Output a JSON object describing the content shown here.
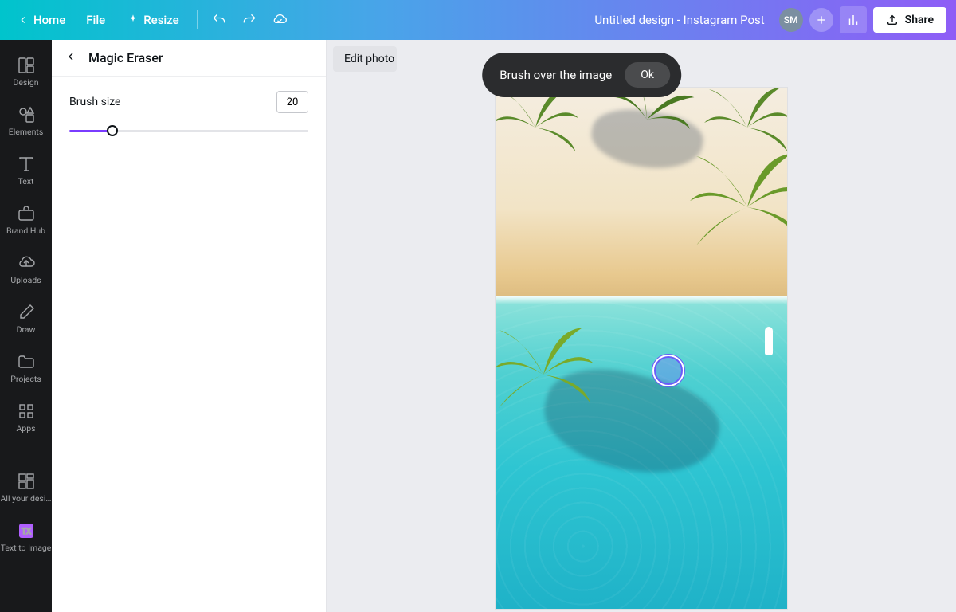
{
  "topbar": {
    "home": "Home",
    "file": "File",
    "resize": "Resize",
    "title": "Untitled design - Instagram Post",
    "avatar_initials": "SM",
    "share": "Share"
  },
  "rail": {
    "items": [
      {
        "label": "Design"
      },
      {
        "label": "Elements"
      },
      {
        "label": "Text"
      },
      {
        "label": "Brand Hub"
      },
      {
        "label": "Uploads"
      },
      {
        "label": "Draw"
      },
      {
        "label": "Projects"
      },
      {
        "label": "Apps"
      },
      {
        "label": "All your desi…"
      },
      {
        "label": "Text to Image"
      }
    ]
  },
  "panel": {
    "title": "Magic Eraser",
    "brush_label": "Brush size",
    "brush_value": "20"
  },
  "canvas": {
    "edit_photo_label": "Edit photo",
    "toast_message": "Brush over the image",
    "toast_action": "Ok"
  },
  "colors": {
    "accent": "#7a3cff"
  }
}
